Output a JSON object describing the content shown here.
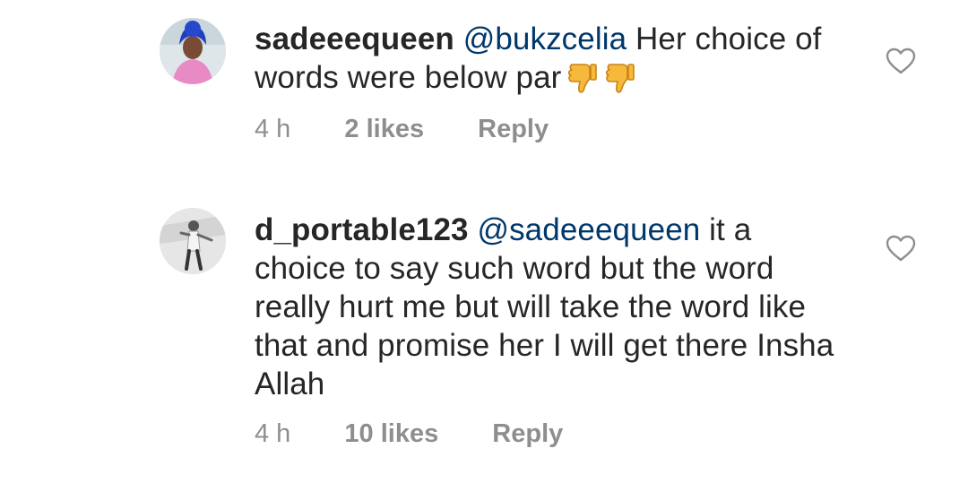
{
  "comments": [
    {
      "username": "sadeeequeen",
      "mention": "@bukzcelia",
      "text": "Her choice of words were below par",
      "emoji": [
        "thumbs-down-icon",
        "thumbs-down-icon"
      ],
      "time": "4 h",
      "likes": "2 likes",
      "reply_label": "Reply"
    },
    {
      "username": "d_portable123",
      "mention": "@sadeeequeen",
      "text": "it a choice to say such word but the word really hurt me but will take the word like that and promise her I will get there Insha Allah",
      "time": "4 h",
      "likes": "10 likes",
      "reply_label": "Reply"
    }
  ],
  "icons": {
    "like": "heart-outline-icon",
    "reaction": "thumbs-down-icon"
  },
  "colors": {
    "text": "#262626",
    "mention": "#00376b",
    "meta": "#8e8e8e",
    "emoji": "#f6b93b"
  }
}
